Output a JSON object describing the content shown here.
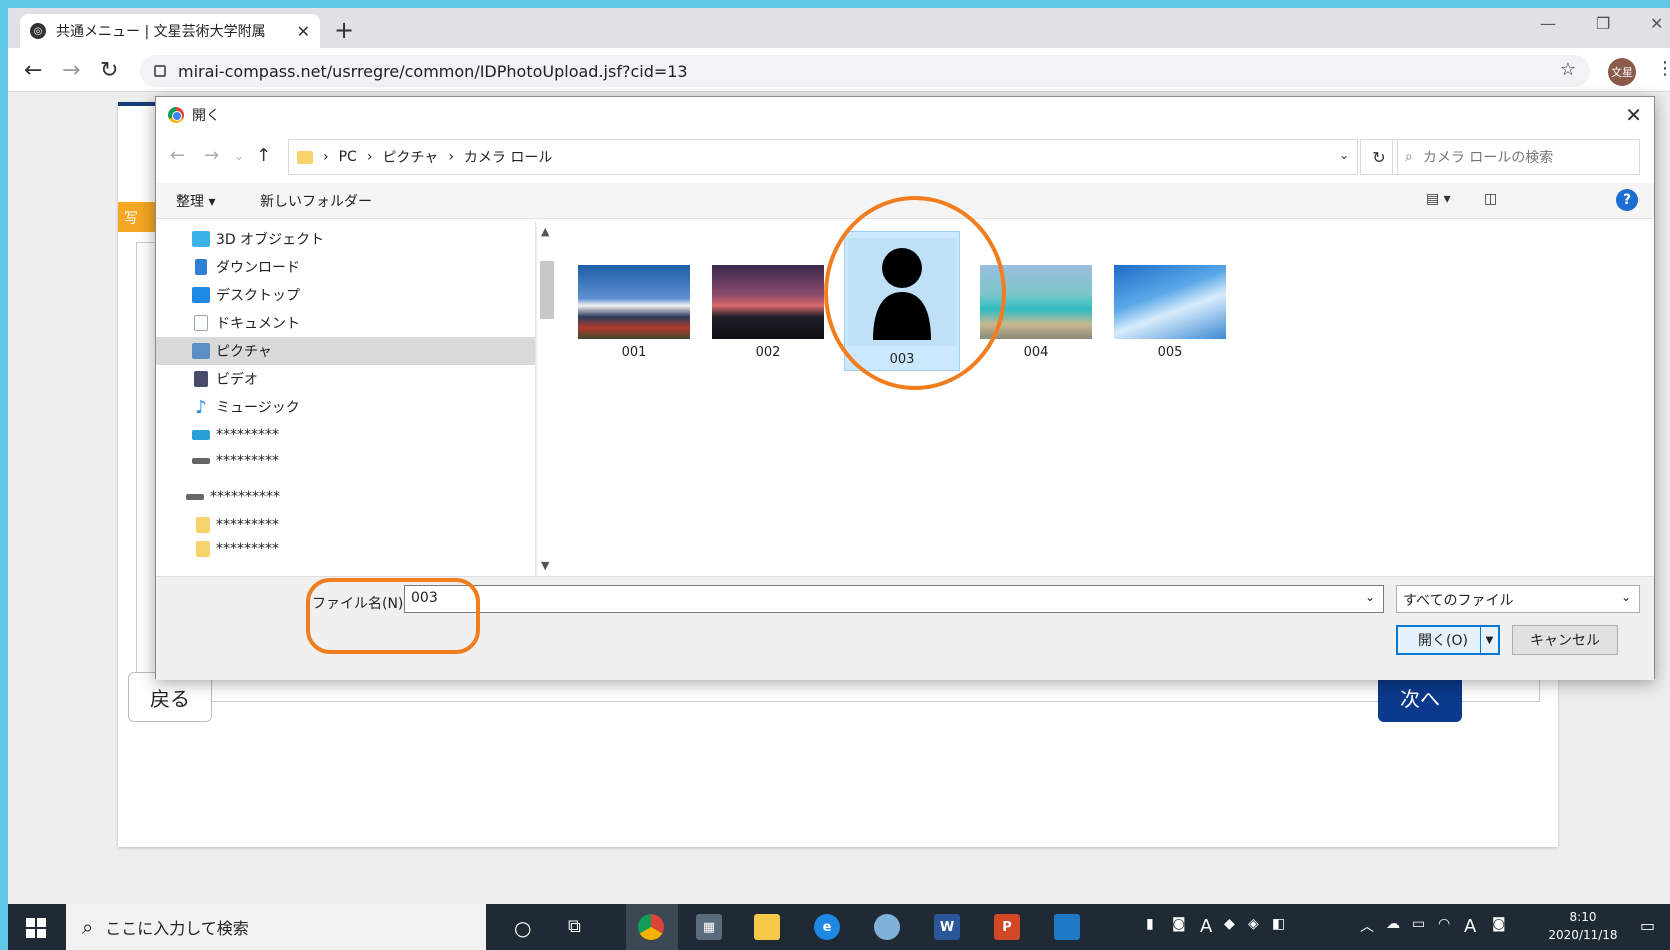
{
  "browser": {
    "tab_title": "共通メニュー | 文星芸術大学附属",
    "url": "mirai-compass.net/usrregre/common/IDPhotoUpload.jsf?cid=13",
    "profile_label": "文星"
  },
  "page": {
    "orange_tab_label": "写",
    "back_label": "戻る",
    "next_label": "次へ"
  },
  "dialog": {
    "title": "開く",
    "breadcrumb": [
      "PC",
      "ピクチャ",
      "カメラ ロール"
    ],
    "search_placeholder": "カメラ ロールの検索",
    "organize_label": "整理 ▾",
    "new_folder_label": "新しいフォルダー",
    "nav_items": [
      {
        "label": "3D オブジェクト",
        "icon": "cube-icon",
        "color": "#3bb3e6"
      },
      {
        "label": "ダウンロード",
        "icon": "download-icon",
        "color": "#2f7fd6"
      },
      {
        "label": "デスクトップ",
        "icon": "desktop-icon",
        "color": "#1e88e5"
      },
      {
        "label": "ドキュメント",
        "icon": "document-icon",
        "color": "#9aa4ad"
      },
      {
        "label": "ピクチャ",
        "icon": "pictures-icon",
        "color": "#5a8fc2"
      },
      {
        "label": "ビデオ",
        "icon": "video-icon",
        "color": "#4a4a6a"
      },
      {
        "label": "ミュージック",
        "icon": "music-icon",
        "color": "#1e88e5"
      },
      {
        "label": "*********",
        "icon": "network-drive-icon",
        "color": "#2aa0d8"
      },
      {
        "label": "*********",
        "icon": "drive-icon",
        "color": "#666666"
      },
      {
        "label": "**********",
        "icon": "drive-icon",
        "color": "#666666"
      },
      {
        "label": "*********",
        "icon": "folder-icon",
        "color": "#f7d46b"
      },
      {
        "label": "*********",
        "icon": "folder-icon",
        "color": "#f7d46b"
      }
    ],
    "files": [
      {
        "name": "001",
        "kind": "fuji1"
      },
      {
        "name": "002",
        "kind": "fuji2"
      },
      {
        "name": "003",
        "kind": "person",
        "selected": true
      },
      {
        "name": "004",
        "kind": "beach"
      },
      {
        "name": "005",
        "kind": "sky"
      }
    ],
    "filename_label": "ファイル名(N):",
    "filename_value": "003",
    "filter_label": "すべてのファイル",
    "open_label": "開く(O)",
    "cancel_label": "キャンセル"
  },
  "taskbar": {
    "search_placeholder": "ここに入力して検索",
    "time": "8:10",
    "date": "2020/11/18"
  },
  "colors": {
    "highlight_ring": "#f27d1f",
    "next_button": "#0b3a8c",
    "selected_item": "#cce8ff"
  }
}
